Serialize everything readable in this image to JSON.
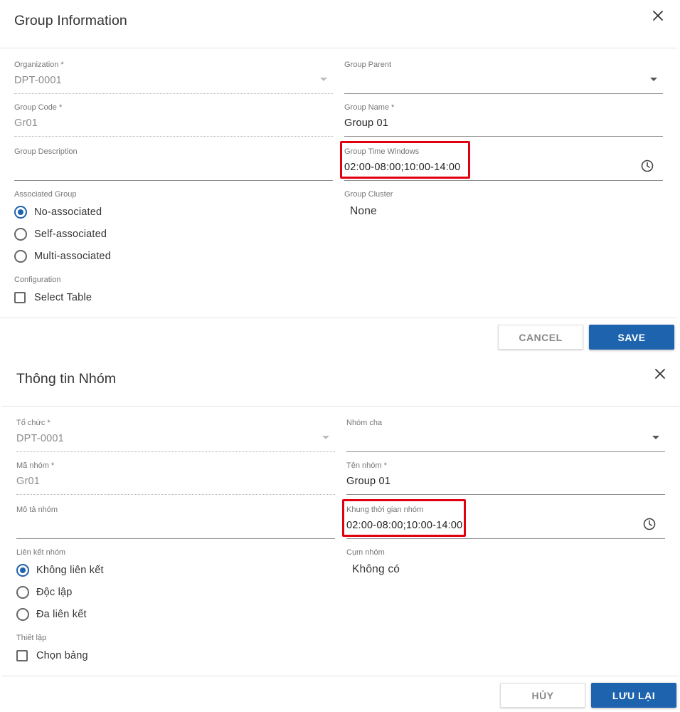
{
  "colors": {
    "primary": "#1e63ad",
    "highlight": "#e0000f"
  },
  "icons": {
    "close": "close-icon",
    "clock": "clock-icon",
    "dropdown": "chevron-down-icon"
  },
  "en": {
    "title": "Group Information",
    "organization": {
      "label": "Organization *",
      "value": "DPT-0001"
    },
    "group_parent": {
      "label": "Group Parent",
      "value": ""
    },
    "group_code": {
      "label": "Group Code *",
      "value": "Gr01"
    },
    "group_name": {
      "label": "Group Name *",
      "value": "Group 01"
    },
    "group_description": {
      "label": "Group Description",
      "value": ""
    },
    "group_time_windows": {
      "label": "Group Time Windows",
      "value": "02:00-08:00;10:00-14:00"
    },
    "associated_group": {
      "label": "Associated Group",
      "options": [
        "No-associated",
        "Self-associated",
        "Multi-associated"
      ],
      "selected": "No-associated"
    },
    "group_cluster": {
      "label": "Group Cluster",
      "value": "None"
    },
    "configuration": {
      "label": "Configuration",
      "checkbox": "Select Table"
    },
    "cancel_label": "CANCEL",
    "save_label": "SAVE"
  },
  "vi": {
    "title": "Thông tin Nhóm",
    "organization": {
      "label": "Tổ chức *",
      "value": "DPT-0001"
    },
    "group_parent": {
      "label": "Nhóm cha",
      "value": ""
    },
    "group_code": {
      "label": "Mã nhóm *",
      "value": "Gr01"
    },
    "group_name": {
      "label": "Tên nhóm *",
      "value": "Group 01"
    },
    "group_description": {
      "label": "Mô tả nhóm",
      "value": ""
    },
    "group_time_windows": {
      "label": "Khung thời gian nhóm",
      "value": "02:00-08:00;10:00-14:00"
    },
    "associated_group": {
      "label": "Liên kết nhóm",
      "options": [
        "Không liên kết",
        "Độc lập",
        "Đa liên kết"
      ],
      "selected": "Không liên kết"
    },
    "group_cluster": {
      "label": "Cụm nhóm",
      "value": "Không có"
    },
    "configuration": {
      "label": "Thiết lập",
      "checkbox": "Chọn bảng"
    },
    "cancel_label": "HỦY",
    "save_label": "LƯU LẠI"
  }
}
